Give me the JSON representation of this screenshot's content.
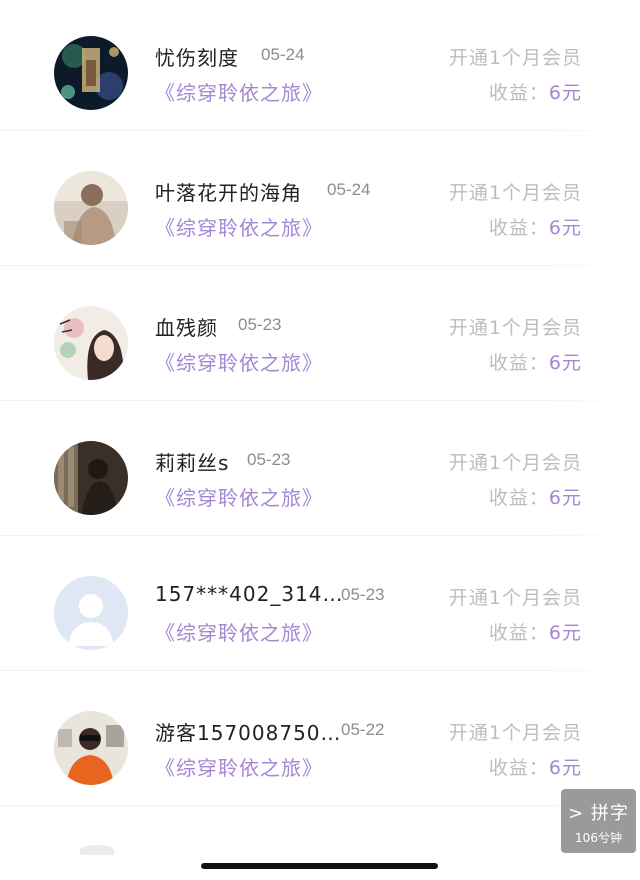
{
  "records": [
    {
      "name": "忧伤刻度",
      "date": "05-24",
      "book": "《综穿聆依之旅》",
      "action": "开通1个月会员",
      "earn_label": "收益：",
      "earn_amount": "6元"
    },
    {
      "name": "叶落花开的海角",
      "date": "05-24",
      "book": "《综穿聆依之旅》",
      "action": "开通1个月会员",
      "earn_label": "收益：",
      "earn_amount": "6元"
    },
    {
      "name": "血残颜",
      "date": "05-23",
      "book": "《综穿聆依之旅》",
      "action": "开通1个月会员",
      "earn_label": "收益：",
      "earn_amount": "6元"
    },
    {
      "name": "莉莉丝s",
      "date": "05-23",
      "book": "《综穿聆依之旅》",
      "action": "开通1个月会员",
      "earn_label": "收益：",
      "earn_amount": "6元"
    },
    {
      "name": "157***402_314…",
      "date": "05-23",
      "book": "《综穿聆依之旅》",
      "action": "开通1个月会员",
      "earn_label": "收益：",
      "earn_amount": "6元"
    },
    {
      "name": "游客157008750…",
      "date": "05-22",
      "book": "《综穿聆依之旅》",
      "action": "开通1个月会员",
      "earn_label": "收益：",
      "earn_amount": "6元"
    }
  ],
  "floating_button": {
    "label": "> 拼字",
    "sub": "106兮钟"
  },
  "colors": {
    "accent": "#a487d3",
    "muted": "#bdbdbd",
    "name": "#222222",
    "date": "#8d8d8d"
  }
}
